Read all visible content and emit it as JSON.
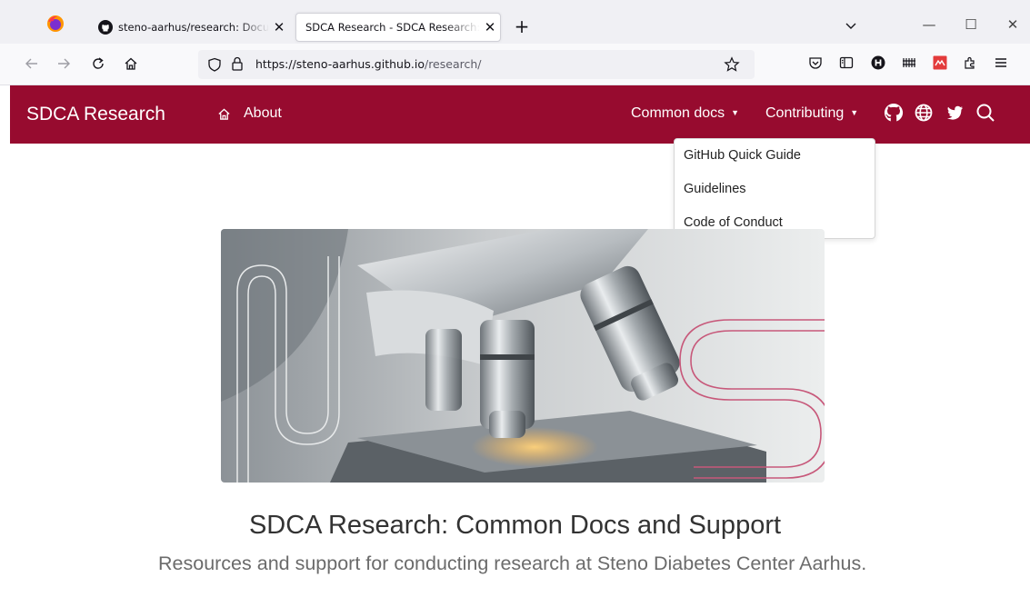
{
  "browser": {
    "tabs": [
      {
        "title": "steno-aarhus/research: Documentation",
        "icon": "github-icon",
        "active": false
      },
      {
        "title": "SDCA Research - SDCA Research: Common Docs",
        "icon": "none",
        "active": true
      }
    ],
    "url_domain": "https://steno-aarhus.github.io",
    "url_path": "/research/",
    "new_tab_label": "+",
    "close_glyph": "✕",
    "window_controls": [
      "—",
      "☐",
      "✕"
    ]
  },
  "site": {
    "brand": "SDCA Research",
    "nav": {
      "about": "About",
      "common_docs": "Common docs",
      "contributing": "Contributing"
    },
    "icons": [
      "home-icon",
      "github-icon",
      "globe-icon",
      "twitter-icon",
      "search-icon"
    ],
    "dropdown": {
      "items": [
        "GitHub Quick Guide",
        "Guidelines",
        "Code of Conduct"
      ]
    },
    "title": "SDCA Research: Common Docs and Support",
    "subtitle": "Resources and support for conducting research at Steno Diabetes Center Aarhus."
  },
  "colors": {
    "brand": "#970b2f",
    "tabstrip": "#f0f0f4",
    "toolbar": "#f9f9fb"
  }
}
